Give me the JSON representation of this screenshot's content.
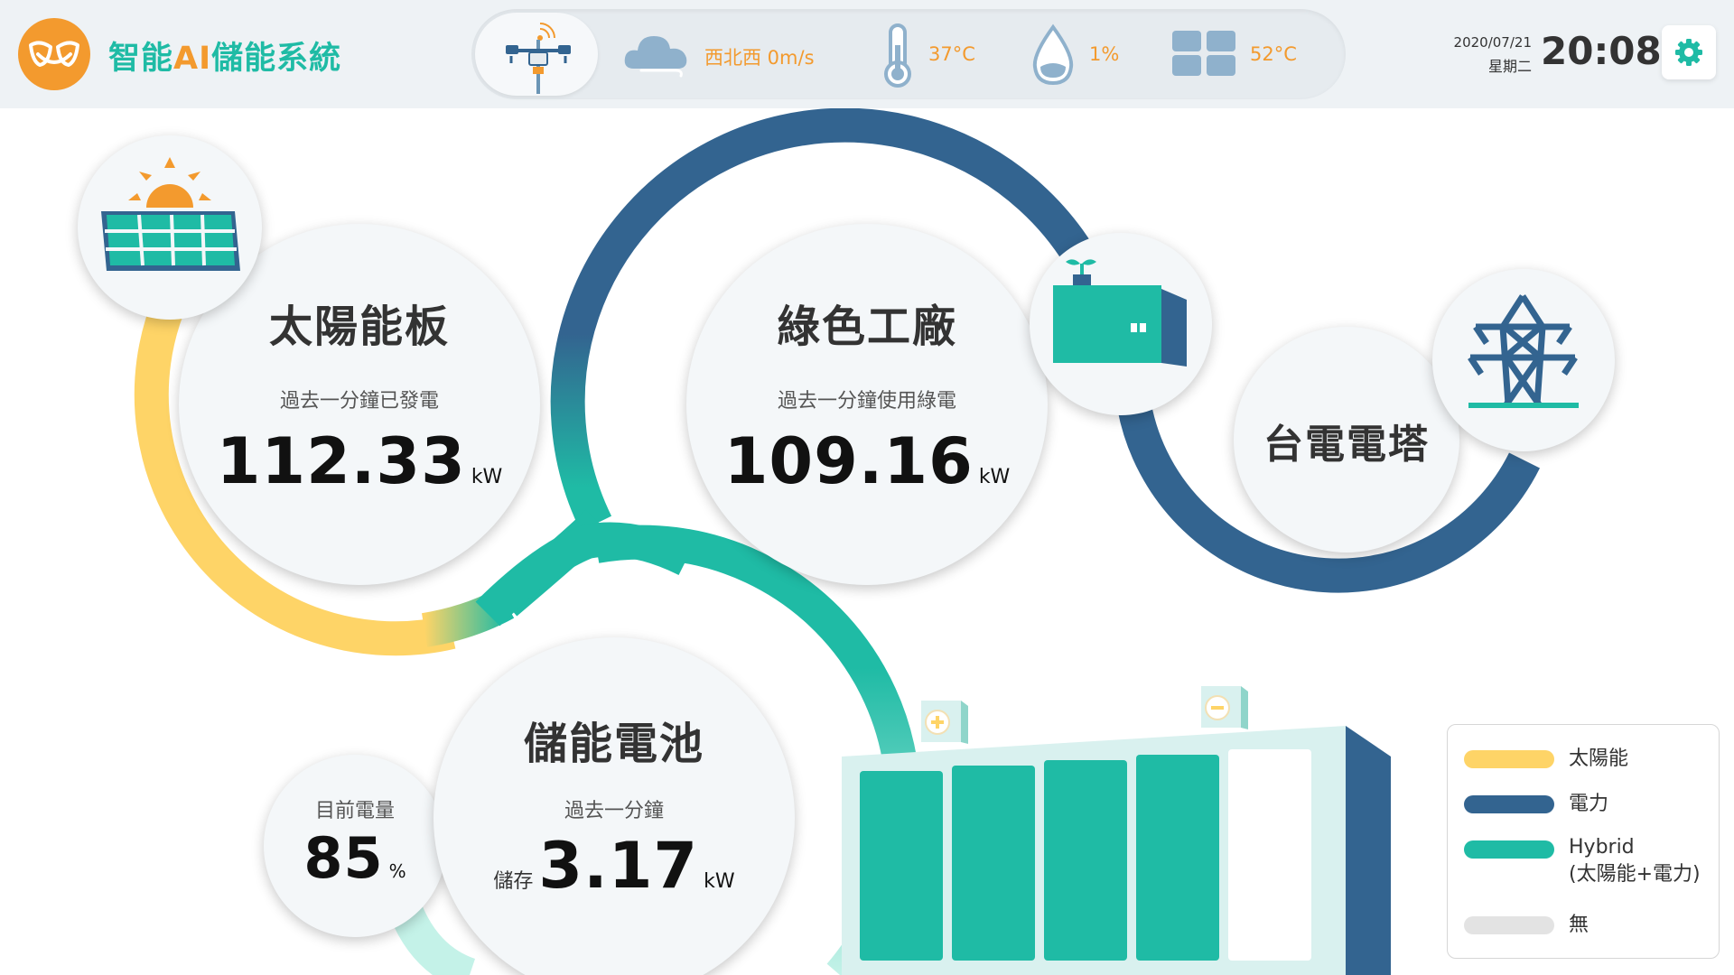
{
  "app": {
    "title_prefix": "智能",
    "title_accent": "AI",
    "title_suffix": "儲能系統"
  },
  "weather": {
    "wind": "西北西 0m/s",
    "temperature": "37°C",
    "humidity": "1%",
    "panel_temperature": "52°C",
    "icons": [
      "weather-station-icon",
      "wind-cloud-icon",
      "thermometer-icon",
      "water-drop-icon",
      "panel-temp-icon"
    ]
  },
  "clock": {
    "date": "2020/07/21",
    "weekday": "星期二",
    "time": "20:08"
  },
  "solar": {
    "title": "太陽能板",
    "subtitle": "過去一分鐘已發電",
    "value": "112.33",
    "unit": "kW"
  },
  "factory": {
    "title": "綠色工廠",
    "subtitle": "過去一分鐘使用綠電",
    "value": "109.16",
    "unit": "kW"
  },
  "grid": {
    "title": "台電電塔"
  },
  "battery": {
    "title": "儲能電池",
    "subtitle": "過去一分鐘",
    "prefix": "儲存",
    "value": "3.17",
    "unit": "kW",
    "charge_label": "目前電量",
    "charge_value": "85",
    "charge_unit": "%",
    "cells_filled": 4,
    "cells_total": 5
  },
  "legend": [
    {
      "label": "太陽能",
      "color": "#fed467"
    },
    {
      "label": "電力",
      "color": "#336490"
    },
    {
      "label": "Hybrid",
      "label2": "(太陽能+電力)",
      "color": "#1fbba5"
    },
    {
      "label": "無",
      "color": "#e3e3e3"
    }
  ],
  "colors": {
    "solar": "#fed467",
    "power": "#336490",
    "hybrid": "#1fbba5",
    "none": "#e3e3e3",
    "accent": "#f39a2e"
  }
}
